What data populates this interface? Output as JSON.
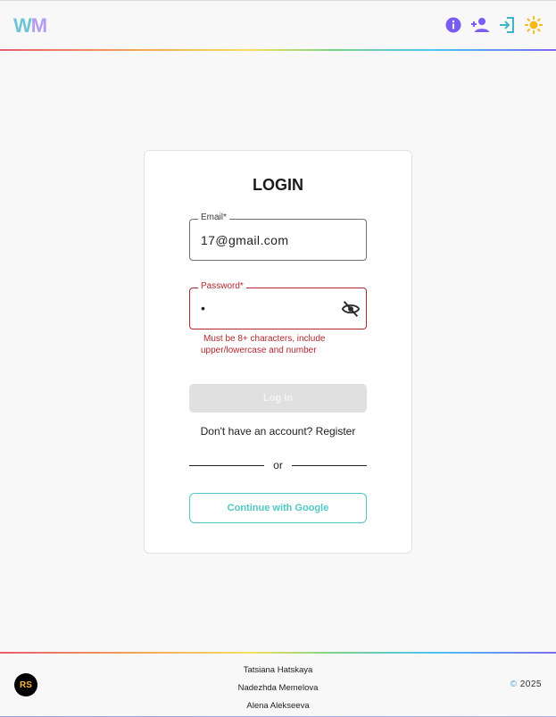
{
  "header": {
    "logo": {
      "w": "W",
      "m": "M"
    },
    "icons": [
      "info-icon",
      "add-user-icon",
      "login-icon",
      "sun-icon"
    ],
    "colors": {
      "accent_purple": "#7a5cf0",
      "accent_teal": "#3fb5c9",
      "sun_yellow": "#f5b91a"
    }
  },
  "login": {
    "title": "LOGIN",
    "email": {
      "label": "Email*",
      "value": "17@gmail.com"
    },
    "password": {
      "label": "Password*",
      "value": "•"
    },
    "error": {
      "line1": "Must be 8+ characters, include",
      "line2": "upper/lowercase and number"
    },
    "login_button": "Log In",
    "register_text": "Don't have an account? Register",
    "divider_text": "or",
    "google_button": "Continue with Google"
  },
  "footer": {
    "rs_logo": "RS",
    "authors": [
      "Tatsiana Hatskaya",
      "Nadezhda Memelova",
      "Alena Alekseeva"
    ],
    "copyright_symbol": "©",
    "copyright_year": "2025"
  }
}
